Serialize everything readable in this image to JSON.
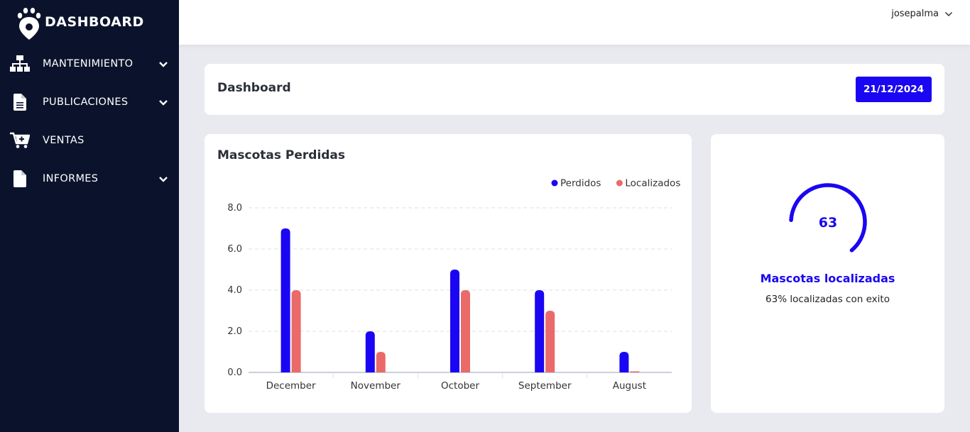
{
  "brand": {
    "title": "DASHBOARD",
    "icon": "paw-location-pin-icon"
  },
  "sidebar": {
    "items": [
      {
        "label": "MANTENIMIENTO",
        "icon": "sitemap-icon",
        "has_submenu": true
      },
      {
        "label": "PUBLICACIONES",
        "icon": "document-icon",
        "has_submenu": true
      },
      {
        "label": "VENTAS",
        "icon": "cart-plus-icon",
        "has_submenu": false
      },
      {
        "label": "INFORMES",
        "icon": "file-icon",
        "has_submenu": true
      }
    ]
  },
  "topbar": {
    "user_name": "josepalma"
  },
  "header": {
    "title": "Dashboard",
    "date": "21/12/2024"
  },
  "chart_card": {
    "title": "Mascotas Perdidas"
  },
  "chart_data": {
    "type": "bar",
    "categories": [
      "December",
      "November",
      "October",
      "September",
      "August"
    ],
    "series": [
      {
        "name": "Perdidos",
        "color": "#1a06f2",
        "values": [
          7,
          2,
          5,
          4,
          1
        ]
      },
      {
        "name": "Localizados",
        "color": "#ea6a6a",
        "values": [
          4,
          1,
          4,
          3,
          0
        ]
      }
    ],
    "ylim": [
      0,
      8
    ],
    "yticks": [
      "0.0",
      "2.0",
      "4.0",
      "6.0",
      "8.0"
    ],
    "legend": "top-right",
    "grid": true
  },
  "stat": {
    "value": "63",
    "percent": 63,
    "title": "Mascotas localizadas",
    "subtitle": "63% localizadas con exito",
    "color": "#1a06f2"
  }
}
